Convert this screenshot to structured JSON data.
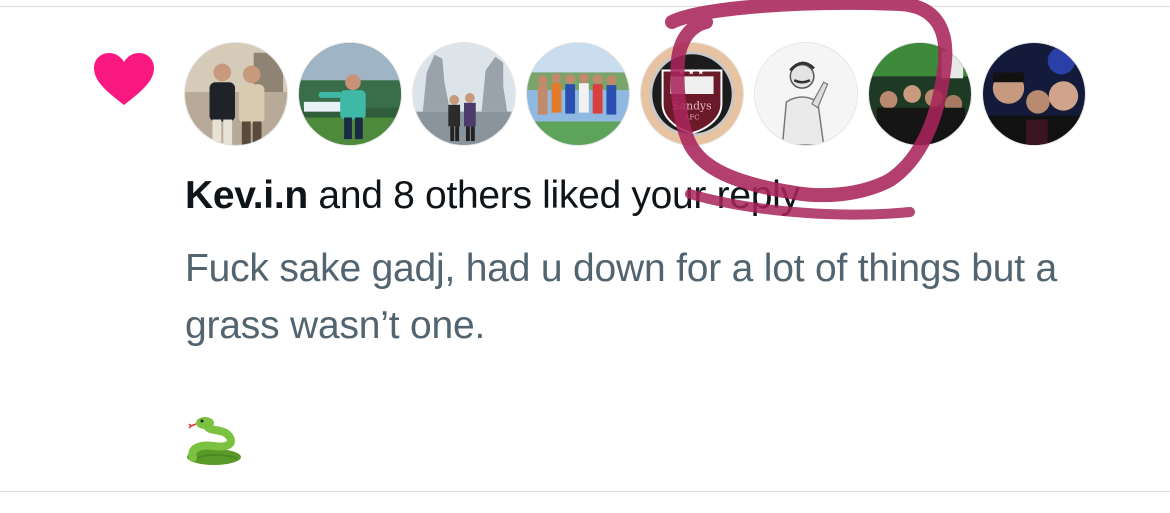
{
  "notification": {
    "icon": "heart-icon",
    "icon_color": "#f91880",
    "liker_name": "Kev.i.n",
    "liked_text": " and 8 others liked your reply",
    "reply_text": "Fuck sake gadj, had u down for a lot of things but a grass wasn’t one.",
    "emoji": "snake-emoji",
    "avatars": [
      {
        "description": "two-men-indoor-photo"
      },
      {
        "description": "goalkeeper-on-pitch"
      },
      {
        "description": "kelpies-statue-group"
      },
      {
        "description": "group-by-pool"
      },
      {
        "description": "sandys-afc-crest",
        "crest_text": "Sandys",
        "crest_sub": "AFC"
      },
      {
        "description": "man-with-mustache-pose"
      },
      {
        "description": "group-in-green-lit-bar"
      },
      {
        "description": "group-selfie-at-night"
      }
    ]
  },
  "annotation": {
    "color": "#a8245a",
    "shape": "circle-scribble"
  }
}
